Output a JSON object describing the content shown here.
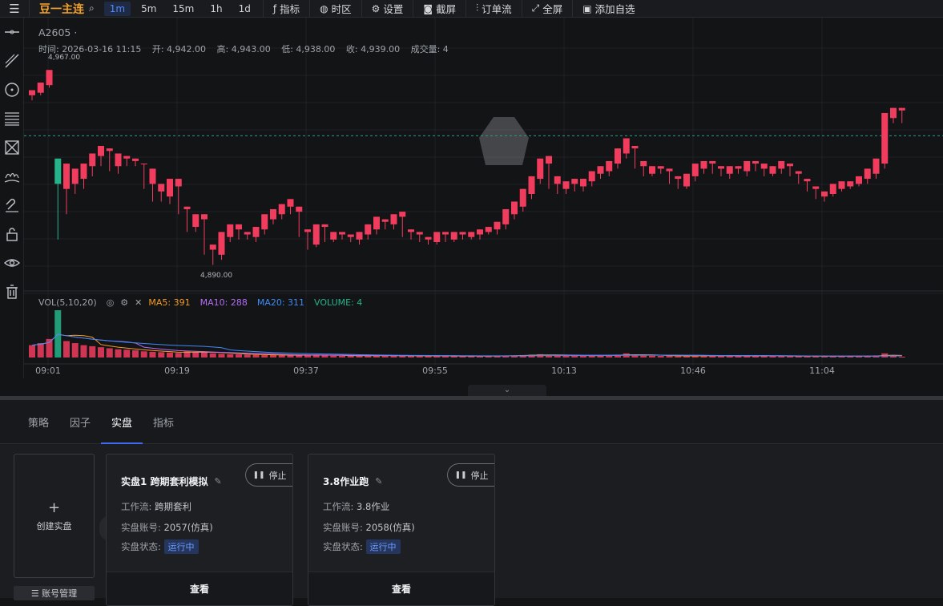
{
  "toolbar": {
    "menu_icon": "menu-icon",
    "symbol": "豆一主连",
    "timeframes": [
      "1m",
      "5m",
      "15m",
      "1h",
      "1d"
    ],
    "active_timeframe": "1m",
    "tools": [
      {
        "label": "指标",
        "icon": "fx-icon"
      },
      {
        "label": "时区",
        "icon": "globe-icon"
      },
      {
        "label": "设置",
        "icon": "gear-icon"
      },
      {
        "label": "截屏",
        "icon": "camera-icon"
      },
      {
        "label": "订单流",
        "icon": "order-flow-icon"
      },
      {
        "label": "全屏",
        "icon": "fullscreen-icon"
      },
      {
        "label": "添加自选",
        "icon": "bookmark-icon"
      }
    ]
  },
  "left_tools": [
    "horizontal-line-icon",
    "trend-line-icon",
    "circle-icon",
    "fib-lines-icon",
    "pattern-icon",
    "gesture-icon",
    "magnet-icon",
    "lock-icon",
    "eye-icon",
    "trash-icon"
  ],
  "chart_header": {
    "symbol_line": "A2605 ·",
    "time": "时间:  2026-03-16 11:15",
    "open": "开:  4,942.00",
    "high": "高:  4,943.00",
    "low": "低:  4,938.00",
    "close": "收:  4,939.00",
    "volume": "成交量:  4"
  },
  "volume_legend": {
    "title": "VOL(5,10,20)",
    "ma5": "MA5: 391",
    "ma10": "MA10: 288",
    "ma20": "MA20: 311",
    "volume": "VOLUME: 4"
  },
  "colors": {
    "up": "#f23c5e",
    "down": "#26b38a",
    "ma5": "#f59a23",
    "ma10": "#b36cf4",
    "ma20": "#3d8af7",
    "accent": "#3d6cf2"
  },
  "chart_data": {
    "type": "candlestick",
    "price_range": [
      4880,
      4975
    ],
    "high_marker": "4,967.00",
    "low_marker": "4,890.00",
    "last_price_line": 4941,
    "x_ticks": [
      "09:01",
      "09:19",
      "09:37",
      "09:55",
      "10:13",
      "10:46",
      "11:04"
    ],
    "candles": [
      [
        4957,
        4959,
        4955,
        4958
      ],
      [
        4958,
        4962,
        4957,
        4961
      ],
      [
        4961,
        4967,
        4960,
        4965
      ],
      [
        4932,
        4922,
        4900,
        4920
      ],
      [
        4920,
        4930,
        4910,
        4926
      ],
      [
        4922,
        4928,
        4918,
        4924
      ],
      [
        4924,
        4930,
        4920,
        4929
      ],
      [
        4929,
        4934,
        4925,
        4933
      ],
      [
        4933,
        4937,
        4929,
        4935
      ],
      [
        4935,
        4936,
        4927,
        4929
      ],
      [
        4929,
        4934,
        4926,
        4932
      ],
      [
        4932,
        4933,
        4929,
        4931
      ],
      [
        4931,
        4932,
        4929,
        4930
      ],
      [
        4930,
        4930,
        4920,
        4922
      ],
      [
        4922,
        4928,
        4915,
        4919
      ],
      [
        4919,
        4922,
        4915,
        4917
      ],
      [
        4917,
        4924,
        4914,
        4921
      ],
      [
        4921,
        4924,
        4910,
        4912
      ],
      [
        4912,
        4913,
        4903,
        4905
      ],
      [
        4905,
        4910,
        4903,
        4908
      ],
      [
        4908,
        4910,
        4894,
        4896
      ],
      [
        4896,
        4898,
        4890,
        4894
      ],
      [
        4894,
        4903,
        4892,
        4901
      ],
      [
        4901,
        4906,
        4899,
        4904
      ],
      [
        4904,
        4906,
        4900,
        4902
      ],
      [
        4902,
        4903,
        4900,
        4901
      ],
      [
        4901,
        4905,
        4899,
        4904
      ],
      [
        4904,
        4910,
        4902,
        4908
      ],
      [
        4908,
        4912,
        4906,
        4910
      ],
      [
        4910,
        4914,
        4908,
        4913
      ],
      [
        4913,
        4916,
        4910,
        4911
      ],
      [
        4911,
        4913,
        4901,
        4903
      ],
      [
        4903,
        4904,
        4896,
        4898
      ],
      [
        4898,
        4906,
        4897,
        4905
      ],
      [
        4905,
        4906,
        4899,
        4900
      ],
      [
        4900,
        4903,
        4899,
        4902
      ],
      [
        4902,
        4903,
        4900,
        4901
      ],
      [
        4901,
        4902,
        4899,
        4900
      ],
      [
        4900,
        4903,
        4898,
        4902
      ],
      [
        4902,
        4906,
        4900,
        4904
      ],
      [
        4904,
        4909,
        4902,
        4907
      ],
      [
        4907,
        4908,
        4904,
        4906
      ],
      [
        4906,
        4910,
        4904,
        4909
      ],
      [
        4909,
        4911,
        4901,
        4903
      ],
      [
        4903,
        4904,
        4900,
        4902
      ],
      [
        4902,
        4903,
        4899,
        4900
      ],
      [
        4900,
        4901,
        4898,
        4899
      ],
      [
        4899,
        4903,
        4898,
        4902
      ],
      [
        4902,
        4903,
        4899,
        4900
      ],
      [
        4900,
        4903,
        4899,
        4902
      ],
      [
        4902,
        4903,
        4900,
        4901
      ],
      [
        4901,
        4903,
        4900,
        4902
      ],
      [
        4902,
        4904,
        4900,
        4903
      ],
      [
        4903,
        4905,
        4902,
        4904
      ],
      [
        4904,
        4907,
        4902,
        4906
      ],
      [
        4906,
        4912,
        4904,
        4910
      ],
      [
        4910,
        4915,
        4908,
        4913
      ],
      [
        4913,
        4920,
        4911,
        4918
      ],
      [
        4918,
        4925,
        4916,
        4924
      ],
      [
        4924,
        4932,
        4922,
        4930
      ],
      [
        4930,
        4933,
        4920,
        4922
      ],
      [
        4922,
        4925,
        4918,
        4920
      ],
      [
        4920,
        4923,
        4918,
        4922
      ],
      [
        4922,
        4924,
        4919,
        4921
      ],
      [
        4921,
        4924,
        4919,
        4923
      ],
      [
        4923,
        4927,
        4921,
        4926
      ],
      [
        4926,
        4929,
        4924,
        4927
      ],
      [
        4927,
        4931,
        4925,
        4930
      ],
      [
        4930,
        4936,
        4928,
        4934
      ],
      [
        4934,
        4940,
        4932,
        4936
      ],
      [
        4936,
        4937,
        4928,
        4929
      ],
      [
        4929,
        4931,
        4925,
        4926
      ],
      [
        4926,
        4929,
        4925,
        4928
      ],
      [
        4928,
        4929,
        4926,
        4927
      ],
      [
        4927,
        4928,
        4922,
        4924
      ],
      [
        4924,
        4925,
        4920,
        4921
      ],
      [
        4921,
        4926,
        4920,
        4925
      ],
      [
        4925,
        4930,
        4923,
        4928
      ],
      [
        4928,
        4931,
        4926,
        4930
      ],
      [
        4930,
        4931,
        4926,
        4928
      ],
      [
        4928,
        4929,
        4925,
        4926
      ],
      [
        4926,
        4929,
        4924,
        4928
      ],
      [
        4928,
        4929,
        4926,
        4927
      ],
      [
        4927,
        4931,
        4925,
        4930
      ],
      [
        4930,
        4931,
        4927,
        4928
      ],
      [
        4928,
        4930,
        4925,
        4926
      ],
      [
        4926,
        4929,
        4925,
        4928
      ],
      [
        4928,
        4931,
        4926,
        4929
      ],
      [
        4929,
        4930,
        4925,
        4926
      ],
      [
        4926,
        4927,
        4922,
        4923
      ],
      [
        4923,
        4924,
        4919,
        4920
      ],
      [
        4920,
        4921,
        4916,
        4917
      ],
      [
        4917,
        4919,
        4915,
        4918
      ],
      [
        4918,
        4922,
        4917,
        4920
      ],
      [
        4920,
        4923,
        4919,
        4921
      ],
      [
        4921,
        4923,
        4920,
        4922
      ],
      [
        4922,
        4925,
        4921,
        4924
      ],
      [
        4924,
        4928,
        4922,
        4926
      ],
      [
        4926,
        4932,
        4924,
        4930
      ],
      [
        4930,
        4950,
        4928,
        4948
      ],
      [
        4948,
        4952,
        4946,
        4951
      ],
      [
        4951,
        4952,
        4946,
        4947
      ]
    ],
    "volumes": [
      60,
      70,
      90,
      230,
      80,
      70,
      60,
      55,
      50,
      45,
      40,
      38,
      35,
      30,
      28,
      26,
      24,
      22,
      30,
      28,
      26,
      20,
      18,
      16,
      15,
      14,
      13,
      12,
      12,
      11,
      10,
      12,
      14,
      12,
      10,
      9,
      8,
      8,
      9,
      10,
      10,
      9,
      8,
      8,
      9,
      8,
      7,
      7,
      8,
      7,
      6,
      6,
      7,
      8,
      9,
      10,
      10,
      12,
      14,
      16,
      12,
      10,
      9,
      8,
      9,
      10,
      11,
      12,
      14,
      20,
      12,
      10,
      9,
      8,
      8,
      7,
      8,
      9,
      10,
      8,
      7,
      7,
      8,
      9,
      8,
      7,
      7,
      8,
      7,
      6,
      6,
      6,
      7,
      7,
      6,
      6,
      7,
      8,
      10,
      20,
      10,
      4
    ]
  },
  "bottom_tabs": [
    "策略",
    "因子",
    "实盘",
    "指标"
  ],
  "active_bottom_tab": "实盘",
  "create_card": {
    "plus": "+",
    "label": "创建实盘"
  },
  "account_button": "☰ 账号管理",
  "cards": [
    {
      "title": "实盘1 跨期套利模拟",
      "stop": "停止",
      "workflow_label": "工作流:",
      "workflow": "跨期套利",
      "account_label": "实盘账号:",
      "account": "2057(仿真)",
      "status_label": "实盘状态:",
      "status": "运行中",
      "view": "查看"
    },
    {
      "title": "3.8作业跑",
      "stop": "停止",
      "workflow_label": "工作流:",
      "workflow": "3.8作业",
      "account_label": "实盘账号:",
      "account": "2058(仿真)",
      "status_label": "实盘状态:",
      "status": "运行中",
      "view": "查看"
    }
  ]
}
